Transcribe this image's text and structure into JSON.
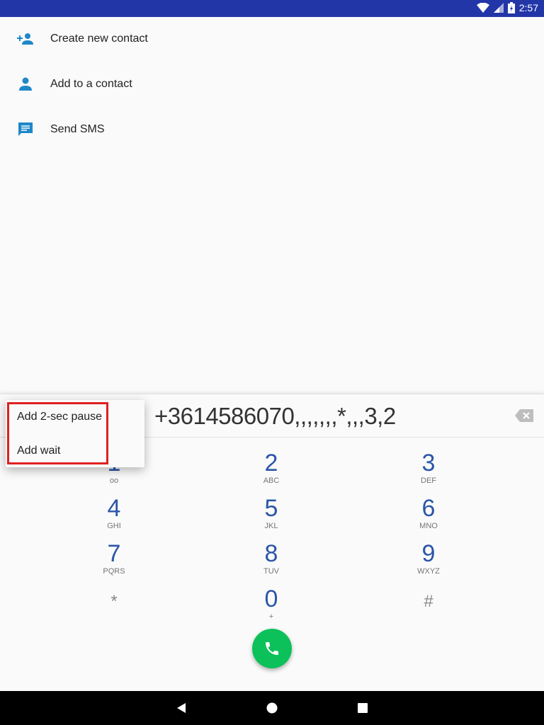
{
  "status_bar": {
    "time": "2:57",
    "icons": [
      "wifi-icon",
      "signal-icon",
      "battery-charging-icon"
    ],
    "color": "#2236a8"
  },
  "actions": [
    {
      "label": "Create new contact",
      "icon": "person-add-icon"
    },
    {
      "label": "Add to a contact",
      "icon": "person-icon"
    },
    {
      "label": "Send SMS",
      "icon": "message-icon"
    }
  ],
  "dialpad": {
    "number": "+3614586070,,,,,,,*,,,3,2",
    "keys": [
      {
        "num": "1",
        "letters": ""
      },
      {
        "num": "2",
        "letters": "ABC"
      },
      {
        "num": "3",
        "letters": "DEF"
      },
      {
        "num": "4",
        "letters": "GHI"
      },
      {
        "num": "5",
        "letters": "JKL"
      },
      {
        "num": "6",
        "letters": "MNO"
      },
      {
        "num": "7",
        "letters": "PQRS"
      },
      {
        "num": "8",
        "letters": "TUV"
      },
      {
        "num": "9",
        "letters": "WXYZ"
      },
      {
        "num": "*",
        "letters": ""
      },
      {
        "num": "0",
        "letters": "+"
      },
      {
        "num": "#",
        "letters": ""
      }
    ],
    "call_color": "#0cc15a"
  },
  "popup_menu": {
    "items": [
      "Add 2-sec pause",
      "Add wait"
    ],
    "highlight_color": "#e02020"
  }
}
